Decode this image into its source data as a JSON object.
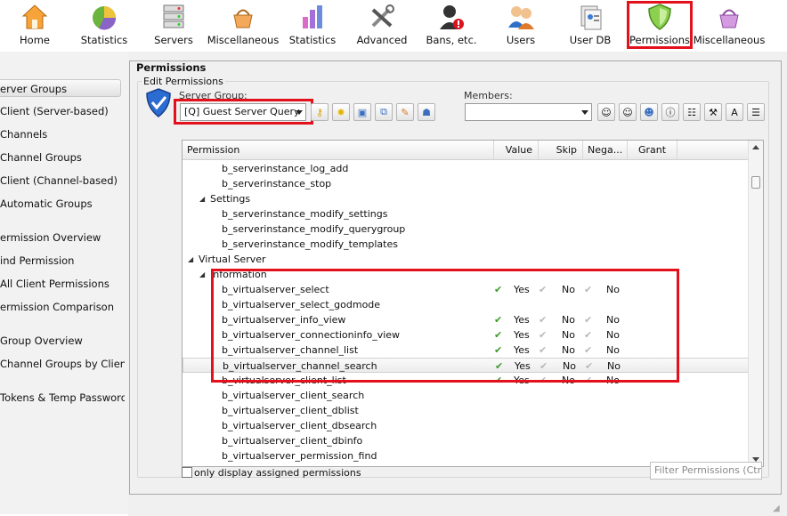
{
  "toolbar": [
    {
      "label": "Home",
      "icon": "home-icon"
    },
    {
      "label": "Statistics",
      "icon": "pie-chart-icon"
    },
    {
      "label": "Servers",
      "icon": "server-rack-icon"
    },
    {
      "label": "Miscellaneous",
      "icon": "basket-icon"
    },
    {
      "label": "Statistics",
      "icon": "bar-chart-icon"
    },
    {
      "label": "Advanced",
      "icon": "tools-icon"
    },
    {
      "label": "Bans, etc.",
      "icon": "banned-user-icon"
    },
    {
      "label": "Users",
      "icon": "users-icon"
    },
    {
      "label": "User DB",
      "icon": "user-db-icon"
    },
    {
      "label": "Permissions",
      "icon": "shield-icon",
      "selected": true
    },
    {
      "label": "Miscellaneous",
      "icon": "basket-icon"
    }
  ],
  "sidebar": {
    "items": [
      {
        "label": "erver Groups",
        "selected": true
      },
      {
        "label": "Client (Server-based)"
      },
      {
        "label": "Channels"
      },
      {
        "label": "Channel Groups"
      },
      {
        "label": "Client (Channel-based)"
      },
      {
        "label": "Automatic Groups"
      },
      {
        "label": "ermission Overview"
      },
      {
        "label": "ind Permission"
      },
      {
        "label": "All Client Permissions"
      },
      {
        "label": "ermission Comparison"
      },
      {
        "label": "Group Overview"
      },
      {
        "label": "Channel Groups by Client"
      },
      {
        "label": "Tokens & Temp Passwords"
      }
    ]
  },
  "panel": {
    "title": "Permissions",
    "group_title": "Edit Permissions",
    "server_group_label": "Server Group:",
    "server_group_value": "[Q] Guest Server Query",
    "members_label": "Members:",
    "members_value": ""
  },
  "colors": {
    "highlight_border": "#e3111b",
    "check_green": "#3c9a2a"
  },
  "table": {
    "columns": [
      "Permission",
      "Value",
      "Skip",
      "Nega...",
      "Grant"
    ],
    "rows": [
      {
        "type": "perm",
        "name": "b_serverinstance_log_add"
      },
      {
        "type": "perm",
        "name": "b_serverinstance_stop"
      },
      {
        "type": "group",
        "name": "Settings",
        "level": 1
      },
      {
        "type": "perm",
        "name": "b_serverinstance_modify_settings"
      },
      {
        "type": "perm",
        "name": "b_serverinstance_modify_querygroup"
      },
      {
        "type": "perm",
        "name": "b_serverinstance_modify_templates"
      },
      {
        "type": "group",
        "name": "Virtual Server",
        "level": 0
      },
      {
        "type": "group",
        "name": "Information",
        "level": 1
      },
      {
        "type": "perm",
        "name": "b_virtualserver_select",
        "value": "Yes",
        "skip": "No",
        "negate": "No"
      },
      {
        "type": "perm",
        "name": "b_virtualserver_select_godmode"
      },
      {
        "type": "perm",
        "name": "b_virtualserver_info_view",
        "value": "Yes",
        "skip": "No",
        "negate": "No"
      },
      {
        "type": "perm",
        "name": "b_virtualserver_connectioninfo_view",
        "value": "Yes",
        "skip": "No",
        "negate": "No"
      },
      {
        "type": "perm",
        "name": "b_virtualserver_channel_list",
        "value": "Yes",
        "skip": "No",
        "negate": "No"
      },
      {
        "type": "perm",
        "name": "b_virtualserver_channel_search",
        "value": "Yes",
        "skip": "No",
        "negate": "No",
        "highlight": true
      },
      {
        "type": "perm",
        "name": "b_virtualserver_client_list",
        "value": "Yes",
        "skip": "No",
        "negate": "No"
      },
      {
        "type": "perm",
        "name": "b_virtualserver_client_search"
      },
      {
        "type": "perm",
        "name": "b_virtualserver_client_dblist"
      },
      {
        "type": "perm",
        "name": "b_virtualserver_client_dbsearch"
      },
      {
        "type": "perm",
        "name": "b_virtualserver_client_dbinfo"
      },
      {
        "type": "perm",
        "name": "b_virtualserver_permission_find"
      }
    ]
  },
  "footer": {
    "only_assigned_label": "only display assigned permissions",
    "filter_placeholder": "Filter Permissions (Ctrl+F)"
  }
}
